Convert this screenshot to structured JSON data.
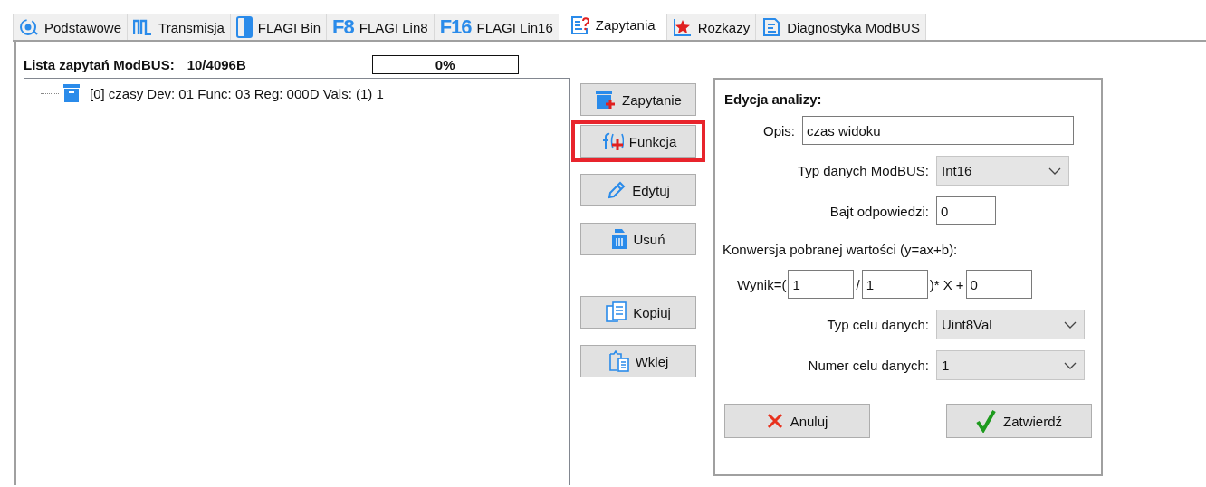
{
  "tabs": [
    {
      "label": "Podstawowe",
      "selected": false
    },
    {
      "label": "Transmisja",
      "selected": false
    },
    {
      "label": "FLAGI Bin",
      "selected": false
    },
    {
      "label": "FLAGI Lin8",
      "selected": false,
      "icon_text": "F8"
    },
    {
      "label": "FLAGI Lin16",
      "selected": false,
      "icon_text": "F16"
    },
    {
      "label": "Zapytania",
      "selected": true
    },
    {
      "label": "Rozkazy",
      "selected": false
    },
    {
      "label": "Diagnostyka ModBUS",
      "selected": false
    }
  ],
  "query_list": {
    "title": "Lista zapytań ModBUS:",
    "size": "10/4096B",
    "progress": {
      "level": 0,
      "text": "0%"
    },
    "tree": [
      {
        "label": "[0] czasy Dev: 01 Func: 03 Reg: 000D Vals: (1) 1"
      }
    ]
  },
  "actions": [
    {
      "label": "Zapytanie",
      "highlighted": false
    },
    {
      "label": "Funkcja",
      "highlighted": true
    },
    {
      "label": "Edytuj",
      "highlighted": false
    },
    {
      "label": "Usuń",
      "highlighted": false
    },
    {
      "label": "Kopiuj",
      "highlighted": false
    },
    {
      "label": "Wklej",
      "highlighted": false
    }
  ],
  "editor": {
    "title": "Edycja analizy:",
    "rows": [
      {
        "kind": "text",
        "label": "Opis:",
        "value": "czas widoku"
      },
      {
        "kind": "select",
        "label": "Typ danych ModBUS:",
        "value": "Int16"
      },
      {
        "kind": "number",
        "label": "Bajt odpowiedzi:",
        "value": "0"
      },
      {
        "kind": "note",
        "text": "Konwersja pobranej wartości (y=ax+b):"
      },
      {
        "kind": "formula",
        "parts": [
          {
            "kind": "text",
            "text": "Wynik=("
          },
          {
            "kind": "input",
            "value": "1"
          },
          {
            "kind": "text",
            "text": "/"
          },
          {
            "kind": "input",
            "value": "1"
          },
          {
            "kind": "text",
            "text": ")* X +"
          },
          {
            "kind": "input",
            "value": "0"
          }
        ]
      },
      {
        "kind": "select",
        "label": "Typ celu danych:",
        "value": "Uint8Val"
      },
      {
        "kind": "select",
        "label": "Numer celu danych:",
        "value": "1"
      }
    ],
    "buttons": [
      {
        "kind": "cancel",
        "label": "Anuluj"
      },
      {
        "kind": "confirm",
        "label": "Zatwierdź"
      }
    ]
  }
}
